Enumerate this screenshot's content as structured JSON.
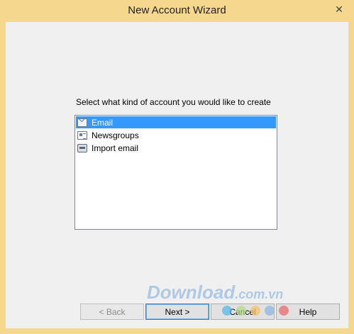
{
  "window": {
    "title": "New Account Wizard",
    "close_glyph": "✕"
  },
  "prompt": "Select what kind of account you would like to create",
  "account_types": [
    {
      "label": "Email",
      "icon": "mail-icon",
      "selected": true
    },
    {
      "label": "Newsgroups",
      "icon": "newsgroup-icon",
      "selected": false
    },
    {
      "label": "Import email",
      "icon": "import-icon",
      "selected": false
    }
  ],
  "buttons": {
    "back": "< Back",
    "next": "Next >",
    "cancel": "Cancel",
    "help": "Help"
  },
  "watermark": {
    "main": "Download",
    "suffix": ".com.vn"
  },
  "colors": {
    "title_bar": "#f5d88e",
    "selection": "#3399ff",
    "dots": [
      "#58b7e8",
      "#b5d98a",
      "#f5c26b",
      "#8fb6e0",
      "#e96b6b"
    ]
  }
}
